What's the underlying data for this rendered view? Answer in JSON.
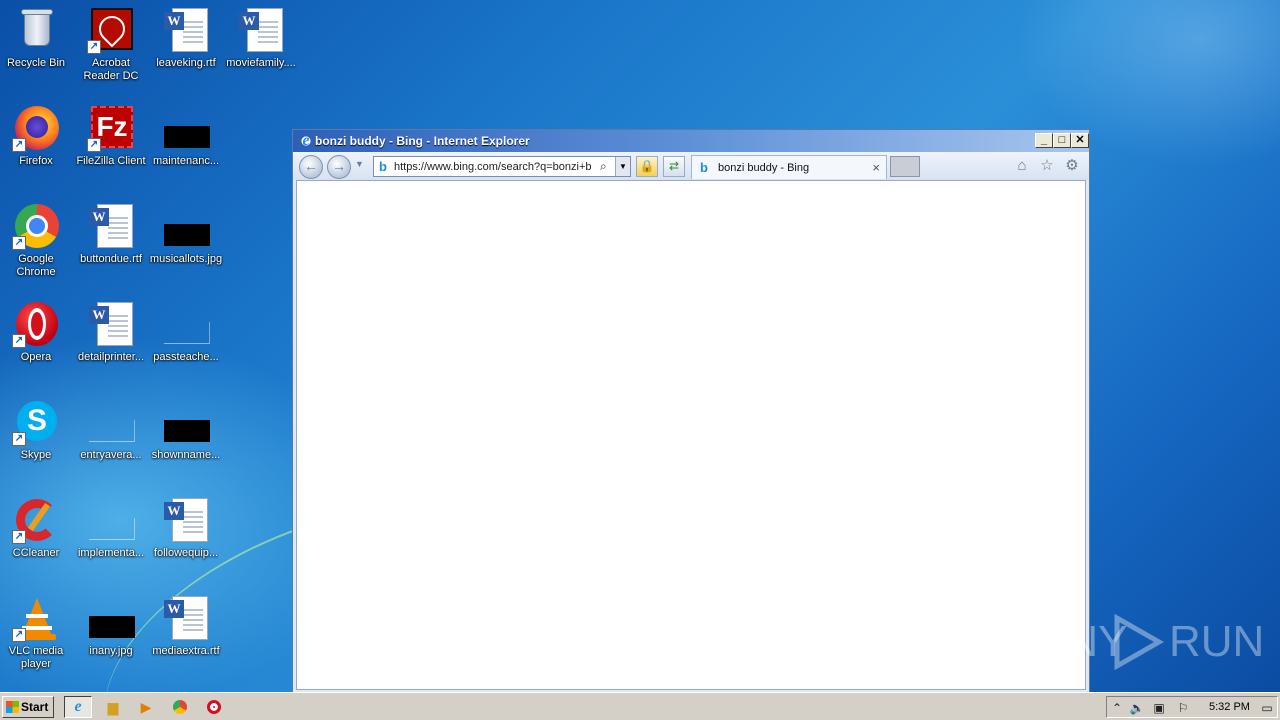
{
  "desktop": {
    "icons": [
      {
        "label": "Recycle Bin"
      },
      {
        "label": "Acrobat Reader DC"
      },
      {
        "label": "leaveking.rtf"
      },
      {
        "label": "moviefamily...."
      },
      {
        "label": "Firefox"
      },
      {
        "label": "FileZilla Client"
      },
      {
        "label": "maintenanc..."
      },
      {
        "label": "Google Chrome"
      },
      {
        "label": "buttondue.rtf"
      },
      {
        "label": "musicallots.jpg"
      },
      {
        "label": "Opera"
      },
      {
        "label": "detailprinter..."
      },
      {
        "label": "passteache..."
      },
      {
        "label": "Skype"
      },
      {
        "label": "entryavera..."
      },
      {
        "label": "shownname..."
      },
      {
        "label": "CCleaner"
      },
      {
        "label": "implementa..."
      },
      {
        "label": "followequip..."
      },
      {
        "label": "VLC media player"
      },
      {
        "label": "inany.jpg"
      },
      {
        "label": "mediaextra.rtf"
      }
    ]
  },
  "ie": {
    "title": "bonzi buddy - Bing - Internet Explorer",
    "address": "https://www.bing.com/search?q=bonzi+b",
    "tab_label": "bonzi buddy - Bing",
    "tab_close": "×",
    "min_glyph": "_",
    "max_glyph": "□",
    "close_glyph": "✕"
  },
  "taskbar": {
    "start_label": "Start",
    "clock": "5:32 PM"
  },
  "watermark": {
    "left": "ANY",
    "right": "RUN"
  },
  "colors": {
    "desktop_blue": "#1a76c9",
    "title_bar_start": "#2d5fb8",
    "taskbar": "#d4d0c8"
  }
}
